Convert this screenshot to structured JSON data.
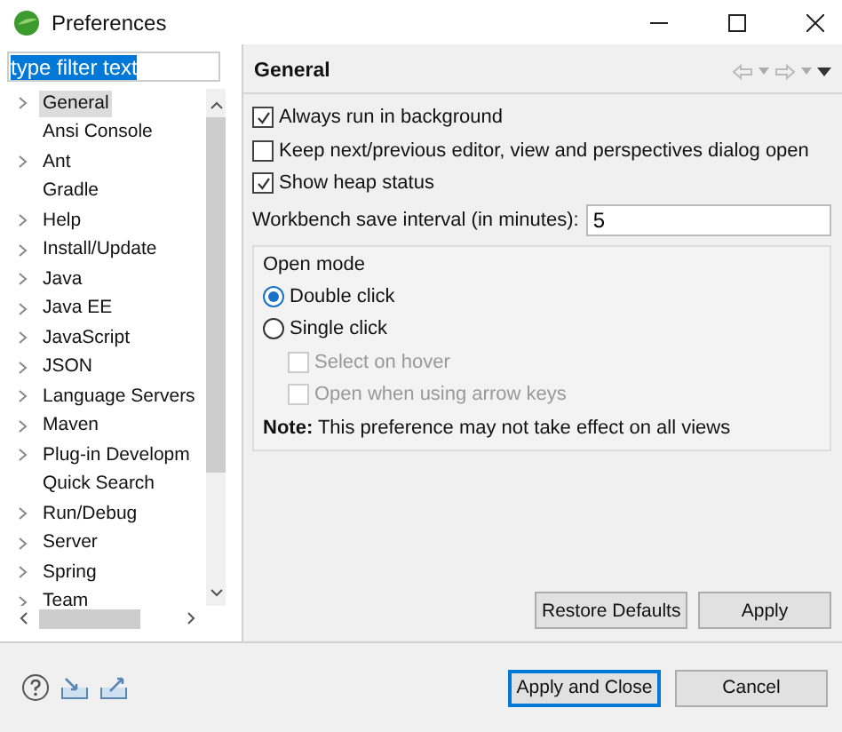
{
  "window": {
    "title": "Preferences"
  },
  "filter": {
    "value": "type filter text"
  },
  "tree": [
    {
      "label": "General",
      "expandable": true,
      "selected": true
    },
    {
      "label": "Ansi Console",
      "expandable": false,
      "selected": false
    },
    {
      "label": "Ant",
      "expandable": true,
      "selected": false
    },
    {
      "label": "Gradle",
      "expandable": false,
      "selected": false
    },
    {
      "label": "Help",
      "expandable": true,
      "selected": false
    },
    {
      "label": "Install/Update",
      "expandable": true,
      "selected": false
    },
    {
      "label": "Java",
      "expandable": true,
      "selected": false
    },
    {
      "label": "Java EE",
      "expandable": true,
      "selected": false
    },
    {
      "label": "JavaScript",
      "expandable": true,
      "selected": false
    },
    {
      "label": "JSON",
      "expandable": true,
      "selected": false
    },
    {
      "label": "Language Servers",
      "expandable": true,
      "selected": false
    },
    {
      "label": "Maven",
      "expandable": true,
      "selected": false
    },
    {
      "label": "Plug-in Developm",
      "expandable": true,
      "selected": false
    },
    {
      "label": "Quick Search",
      "expandable": false,
      "selected": false
    },
    {
      "label": "Run/Debug",
      "expandable": true,
      "selected": false
    },
    {
      "label": "Server",
      "expandable": true,
      "selected": false
    },
    {
      "label": "Spring",
      "expandable": true,
      "selected": false
    },
    {
      "label": "Team",
      "expandable": true,
      "selected": false
    }
  ],
  "page": {
    "title": "General",
    "options": [
      {
        "label": "Always run in background",
        "checked": true
      },
      {
        "label": "Keep next/previous editor, view and perspectives dialog open",
        "checked": false
      },
      {
        "label": "Show heap status",
        "checked": true
      }
    ],
    "save_interval": {
      "label": "Workbench save interval (in minutes):",
      "value": "5"
    },
    "open_mode": {
      "title": "Open mode",
      "choices": [
        {
          "label": "Double click",
          "selected": true
        },
        {
          "label": "Single click",
          "selected": false,
          "children": [
            {
              "label": "Select on hover",
              "checked": false,
              "disabled": true
            },
            {
              "label": "Open when using arrow keys",
              "checked": false,
              "disabled": true
            }
          ]
        }
      ],
      "note_label": "Note:",
      "note": "This preference may not take effect on all views"
    },
    "buttons": [
      "Restore Defaults",
      "Apply"
    ]
  },
  "dialog_buttons": [
    {
      "label": "Apply and Close",
      "default": true
    },
    {
      "label": "Cancel",
      "default": false
    }
  ]
}
